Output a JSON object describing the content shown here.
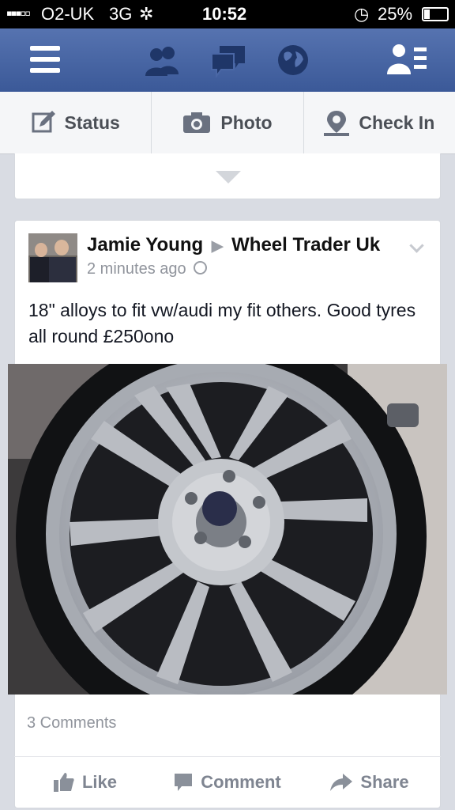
{
  "status_bar": {
    "carrier": "O2-UK",
    "network": "3G",
    "time": "10:52",
    "battery": "25%"
  },
  "nav": {
    "icons": [
      "menu-icon",
      "friends-icon",
      "messages-icon",
      "globe-icon",
      "friend-list-icon"
    ]
  },
  "composer": {
    "status_label": "Status",
    "photo_label": "Photo",
    "checkin_label": "Check In"
  },
  "post": {
    "author": "Jamie Young",
    "group": "Wheel Trader Uk",
    "time": "2 minutes ago",
    "text": "18\" alloys to fit vw/audi my fit others. Good tyres all round £250ono",
    "comments_count": "3 Comments",
    "like_label": "Like",
    "comment_label": "Comment",
    "share_label": "Share"
  },
  "colors": {
    "brand": "#3b5998",
    "status_bar": "#000000",
    "action_text": "#4b4f56",
    "meta_text": "#90949c"
  }
}
